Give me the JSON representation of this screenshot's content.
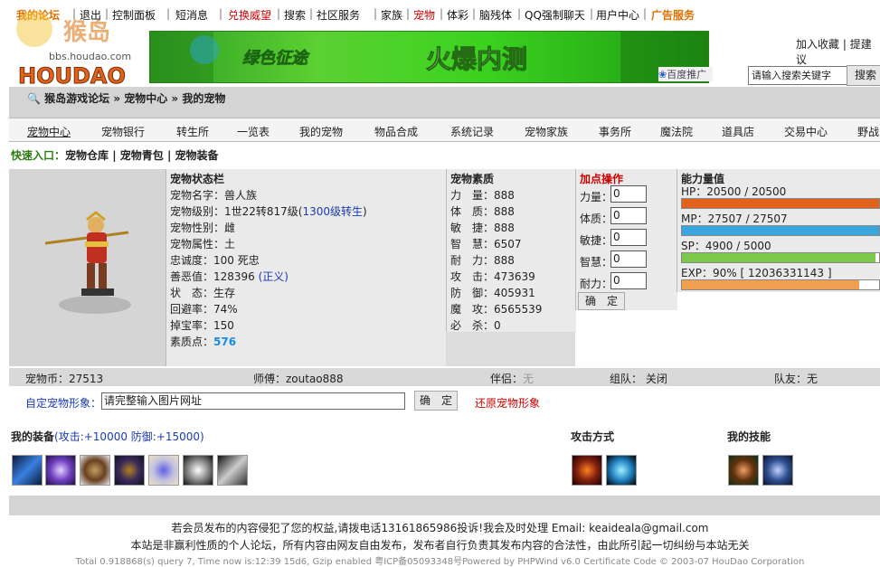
{
  "topnav": {
    "items": [
      {
        "label": "我的论坛",
        "style": "orange"
      },
      {
        "label": "退出",
        "style": ""
      },
      {
        "label": "控制面板",
        "style": ""
      },
      {
        "label": "短消息",
        "style": ""
      },
      {
        "label": "兑换威望",
        "style": "red"
      },
      {
        "label": "搜索",
        "style": ""
      },
      {
        "label": "社区服务",
        "style": ""
      },
      {
        "label": "家族",
        "style": ""
      },
      {
        "label": "宠物",
        "style": "red"
      },
      {
        "label": "体彩",
        "style": ""
      },
      {
        "label": "脑残体",
        "style": ""
      },
      {
        "label": "QQ强制聊天",
        "style": ""
      },
      {
        "label": "用户中心",
        "style": ""
      },
      {
        "label": "广告服务",
        "style": "orange"
      }
    ]
  },
  "logo": {
    "text": "猴岛",
    "sub": "bbs.houdao.com",
    "brand": "HOUDAO"
  },
  "banner": {
    "left_text": "绿色征途",
    "right_text": "火爆内测",
    "ad_label": "百度推广"
  },
  "header": {
    "fav_label": "加入收藏",
    "suggest_label": "提建议",
    "search_placeholder": "请输入搜索关键字",
    "search_btn": "搜索"
  },
  "breadcrumb": "猴岛游戏论坛 » 宠物中心 » 我的宠物",
  "menu": [
    "宠物中心",
    "宠物银行",
    "转生所",
    "一览表",
    "我的宠物",
    "物品合成",
    "系统记录",
    "宠物家族",
    "事务所",
    "魔法院",
    "道具店",
    "交易中心",
    "野战"
  ],
  "quick": {
    "prefix": "快速入口：",
    "links": [
      "宠物仓库",
      "宠物青包",
      "宠物装备"
    ]
  },
  "status": {
    "title": "宠物状态栏",
    "name": "宠物名字：兽人族",
    "level_prefix": "宠物级别：1世22转817级(",
    "level_link": "1300级转生",
    "level_suffix": ")",
    "gender": "宠物性别：雌",
    "attr": "宠物属性：土",
    "loyalty": "忠诚度：100 死忠",
    "karma_prefix": "善恶值：128396 ",
    "karma_tag": "(正义)",
    "state": "状　态：生存",
    "dodge": "回避率：74%",
    "drop": "掉宝率：150",
    "points_label": "素质点：",
    "points": "576"
  },
  "quality": {
    "title": "宠物素质",
    "rows": [
      "力　量：888",
      "体　质：888",
      "敏　捷：888",
      "智　慧：6507",
      "耐　力：888",
      "攻　击：473639",
      "防　御：405931",
      "魔　攻：6565539",
      "必　杀：0"
    ]
  },
  "add": {
    "title": "加点操作",
    "rows": [
      {
        "label": "力量：",
        "value": "0"
      },
      {
        "label": "体质：",
        "value": "0"
      },
      {
        "label": "敏捷：",
        "value": "0"
      },
      {
        "label": "智慧：",
        "value": "0"
      },
      {
        "label": "耐力：",
        "value": "0"
      }
    ],
    "btn": "确　定"
  },
  "ability": {
    "title": "能力量值",
    "hp": {
      "label": "HP：20500 / 20500",
      "pct": 100,
      "color": "#e0621c"
    },
    "mp": {
      "label": "MP：27507 / 27507",
      "pct": 100,
      "color": "#3aa6e0"
    },
    "sp": {
      "label": "SP：4900 / 5000",
      "pct": 98,
      "color": "#7bc84a"
    },
    "exp": {
      "label": "EXP：90% [ 12036331143 ]",
      "pct": 90,
      "color": "#f0a050"
    }
  },
  "info": {
    "coin": "宠物币：27513",
    "master": "师傅：zoutao888",
    "partner_label": "伴侣：",
    "partner": "无",
    "team_label": "组队：",
    "team": "关闭",
    "mate_label": "队友：",
    "mate": "无"
  },
  "custom": {
    "label": "自定宠物形象：",
    "placeholder": "请完整输入图片网址",
    "btn": "确　定",
    "restore": "还原宠物形象"
  },
  "equip": {
    "title": "我的装备",
    "stats": "(攻击:+10000 防御:+15000)"
  },
  "attack_title": "攻击方式",
  "skill_title": "我的技能",
  "footer": {
    "line1": "若会员发布的内容侵犯了您的权益,请拨电话13161865986投诉!我会及时处理 Email: keaideala@gmail.com",
    "line2": "本站是非赢利性质的个人论坛，所有内容由网友自由发布，发布者自行负责其发布内容的合法性，由此所引起一切纠纷与本站无关",
    "line3": "Total 0.918868(s) query 7, Time now is:12:39 15d6, Gzip enabled 粤ICP备05093348号Powered by PHPWind v6.0 Certificate Code © 2003-07 HouDao Corporation"
  }
}
